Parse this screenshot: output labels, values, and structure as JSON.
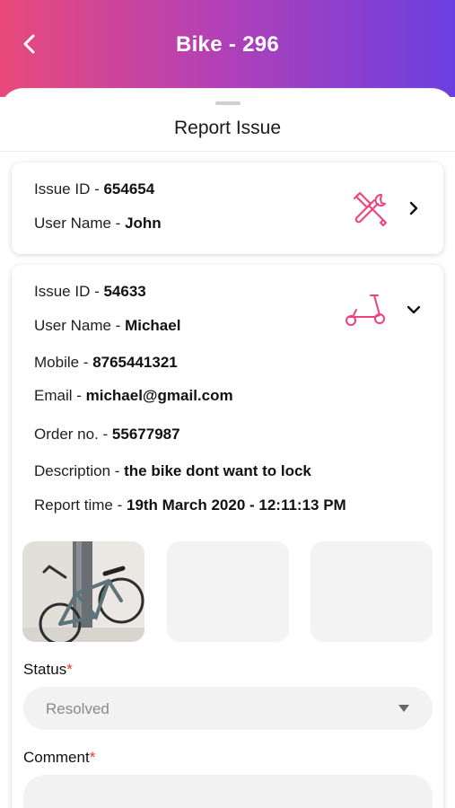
{
  "header": {
    "title": "Bike - 296",
    "back_icon": "chevron-left-icon"
  },
  "sheet": {
    "title": "Report Issue"
  },
  "issues": [
    {
      "id_label": "Issue ID - ",
      "id_value": "654654",
      "user_label": "User Name - ",
      "user_value": "John",
      "icon": "tools-icon",
      "chevron": "chevron-right-icon"
    },
    {
      "id_label": "Issue ID - ",
      "id_value": "54633",
      "user_label": "User Name - ",
      "user_value": "Michael",
      "mobile_label": "Mobile - ",
      "mobile_value": "8765441321",
      "email_label": "Email - ",
      "email_value": "michael@gmail.com",
      "order_label": "Order no. - ",
      "order_value": "55677987",
      "description_label": "Description - ",
      "description_value": "the bike dont want to lock",
      "report_time_label": "Report time - ",
      "report_time_value": "19th March 2020 - 12:11:13 PM",
      "icon": "scooter-icon",
      "chevron": "chevron-down-icon"
    }
  ],
  "status": {
    "label": "Status",
    "required_mark": "*",
    "value": "Resolved"
  },
  "comment": {
    "label": "Comment",
    "required_mark": "*",
    "value": ""
  },
  "colors": {
    "accent_pink": "#e94a7b",
    "accent_purple": "#6a3fe0",
    "icon_pink": "#f0417a"
  }
}
